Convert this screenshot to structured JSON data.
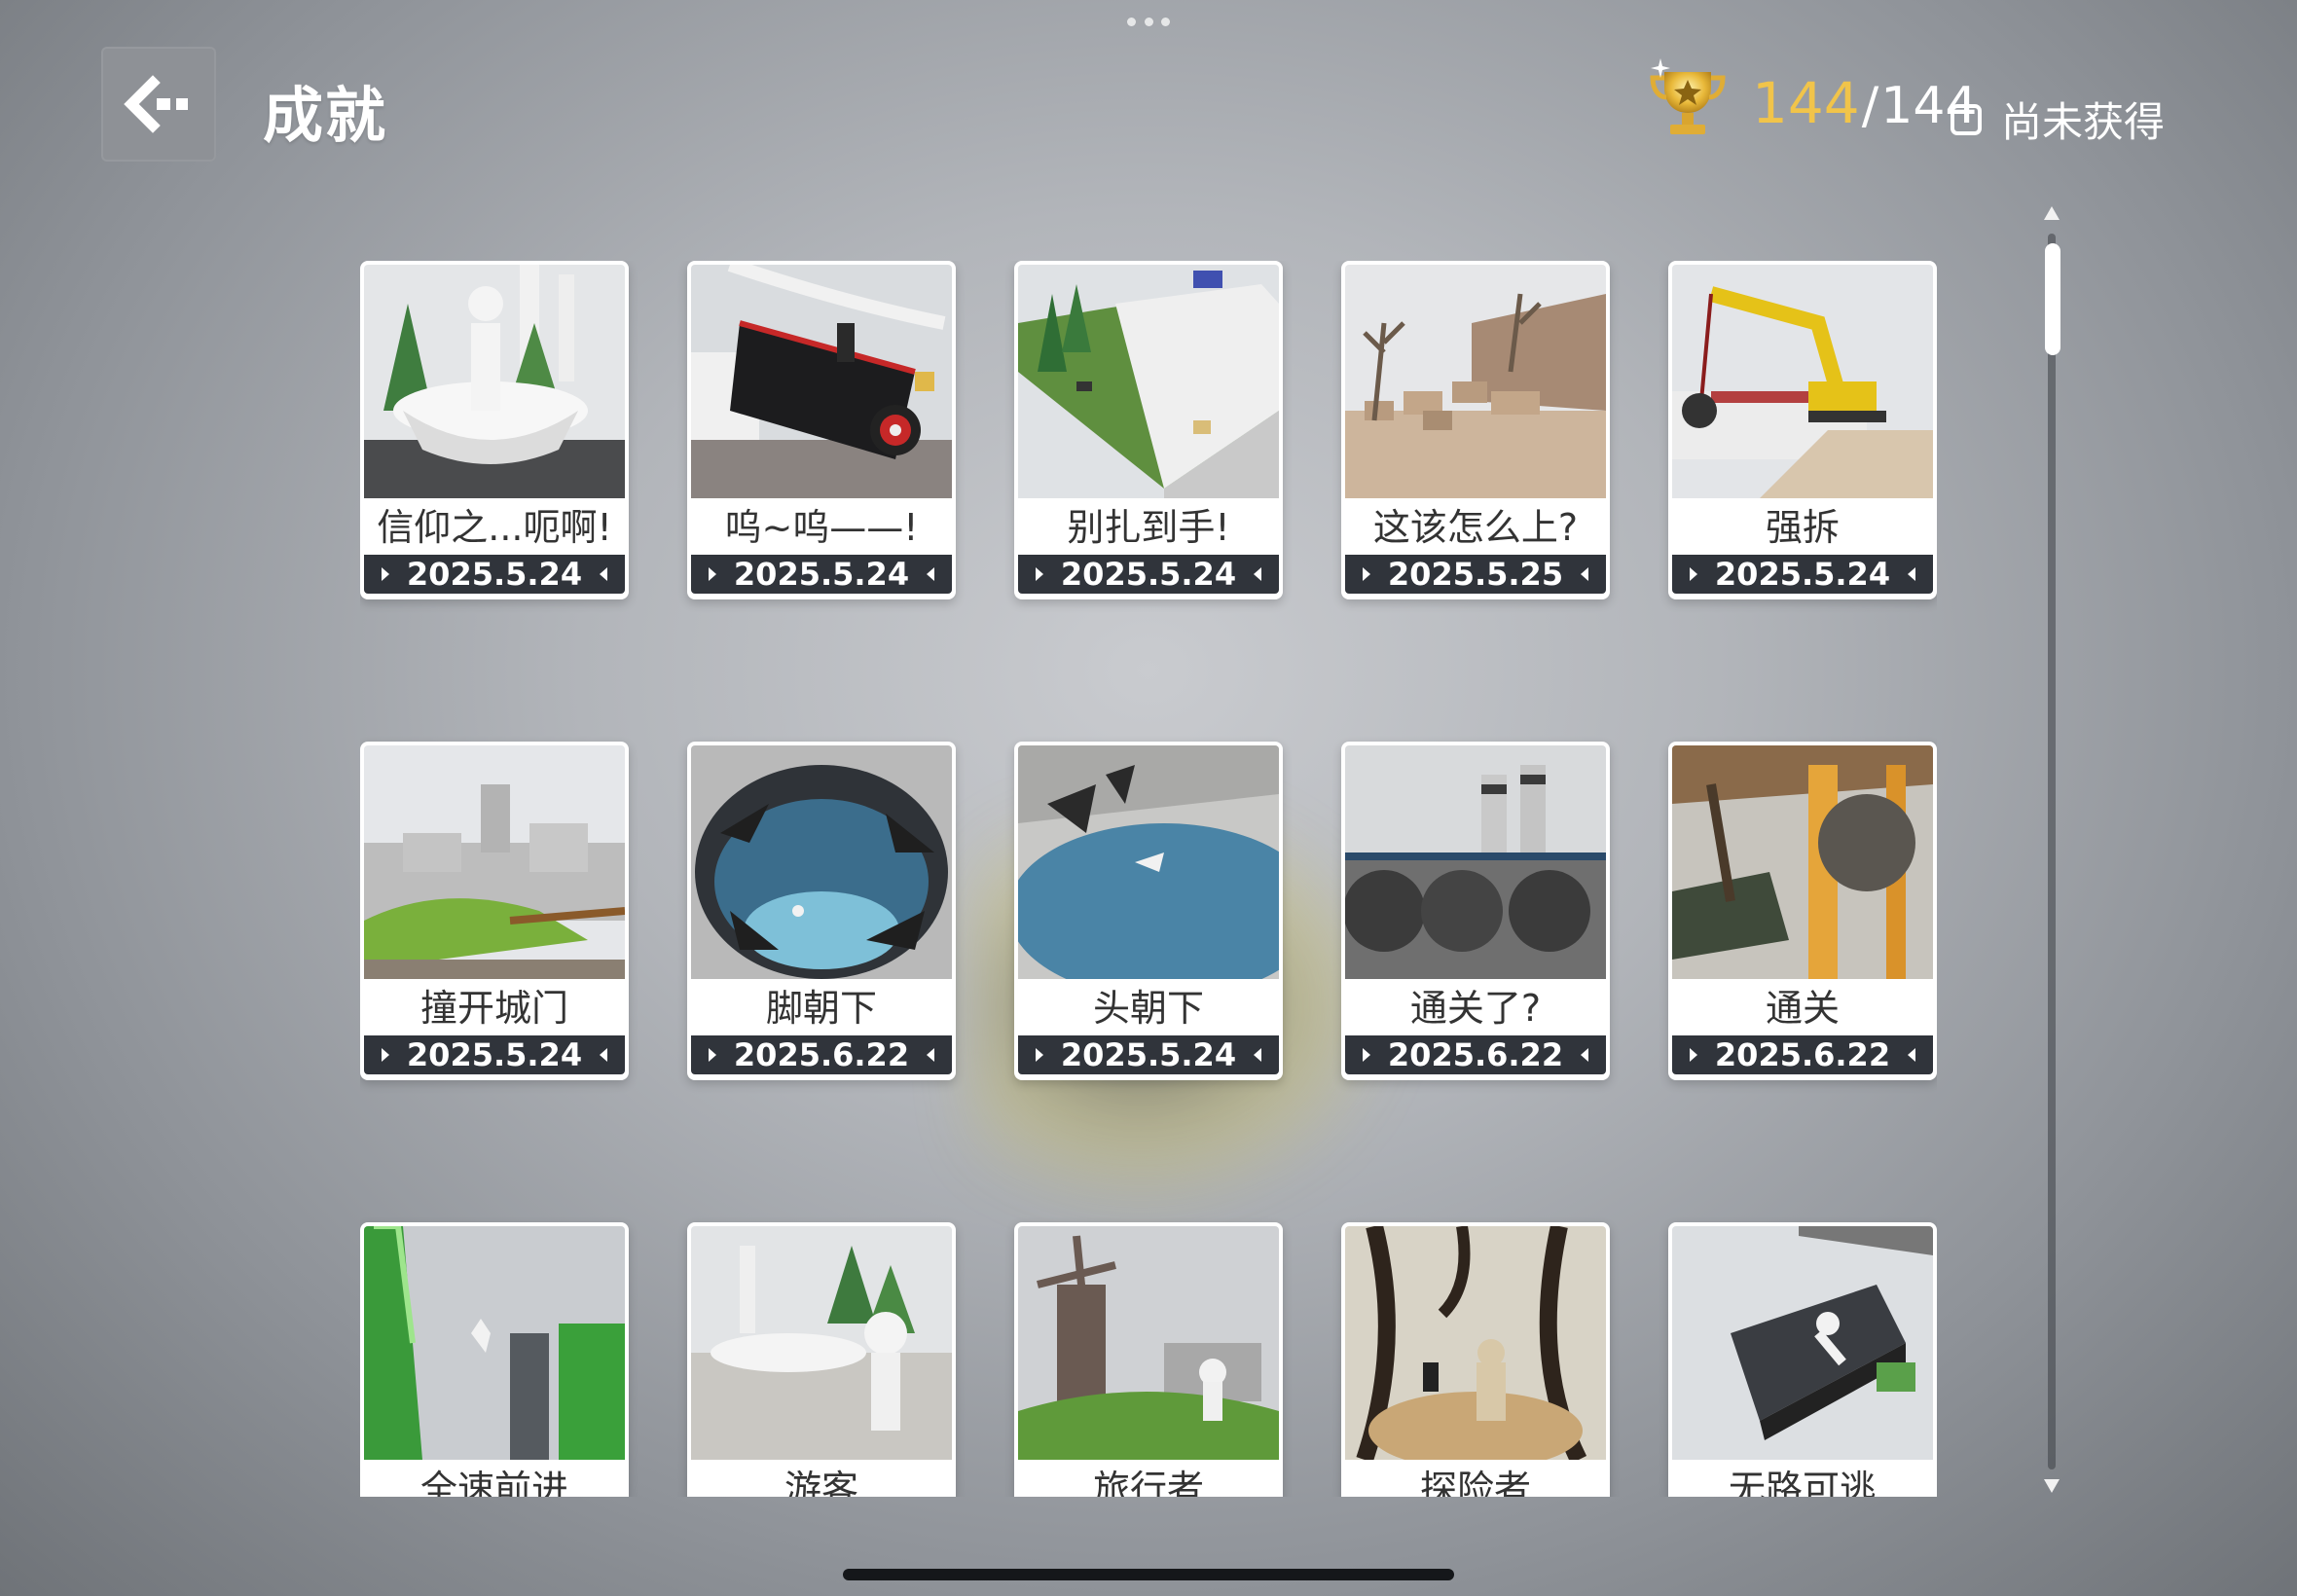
{
  "header": {
    "back_icon": "back-arrow-icon",
    "title": "成就",
    "trophy_icon": "trophy-icon",
    "unlocked_count": "144",
    "separator": "/",
    "total_count": "144",
    "legend_label": "尚未获得"
  },
  "colors": {
    "accent_gold": "#f1c44a",
    "card_bg": "#ffffff",
    "date_bar": "#30343b"
  },
  "achievements": [
    {
      "name": "信仰之...呃啊!",
      "date": "2025.5.24",
      "scene": "fountain"
    },
    {
      "name": "呜~呜——!",
      "date": "2025.5.24",
      "scene": "train"
    },
    {
      "name": "别扎到手!",
      "date": "2025.5.24",
      "scene": "walls"
    },
    {
      "name": "这该怎么上?",
      "date": "2025.5.25",
      "scene": "desert"
    },
    {
      "name": "强拆",
      "date": "2025.5.24",
      "scene": "excavator"
    },
    {
      "name": "撞开城门",
      "date": "2025.5.24",
      "scene": "castle"
    },
    {
      "name": "脚朝下",
      "date": "2025.6.22",
      "scene": "pool"
    },
    {
      "name": "头朝下",
      "date": "2025.5.24",
      "scene": "pool2"
    },
    {
      "name": "通关了?",
      "date": "2025.6.22",
      "scene": "factory"
    },
    {
      "name": "通关",
      "date": "2025.6.22",
      "scene": "gear"
    },
    {
      "name": "全速前进",
      "date": "",
      "scene": "green"
    },
    {
      "name": "游客",
      "date": "",
      "scene": "tourist"
    },
    {
      "name": "旅行者",
      "date": "",
      "scene": "windmill"
    },
    {
      "name": "探险者",
      "date": "",
      "scene": "cave"
    },
    {
      "name": "无路可逃",
      "date": "",
      "scene": "escape"
    }
  ]
}
